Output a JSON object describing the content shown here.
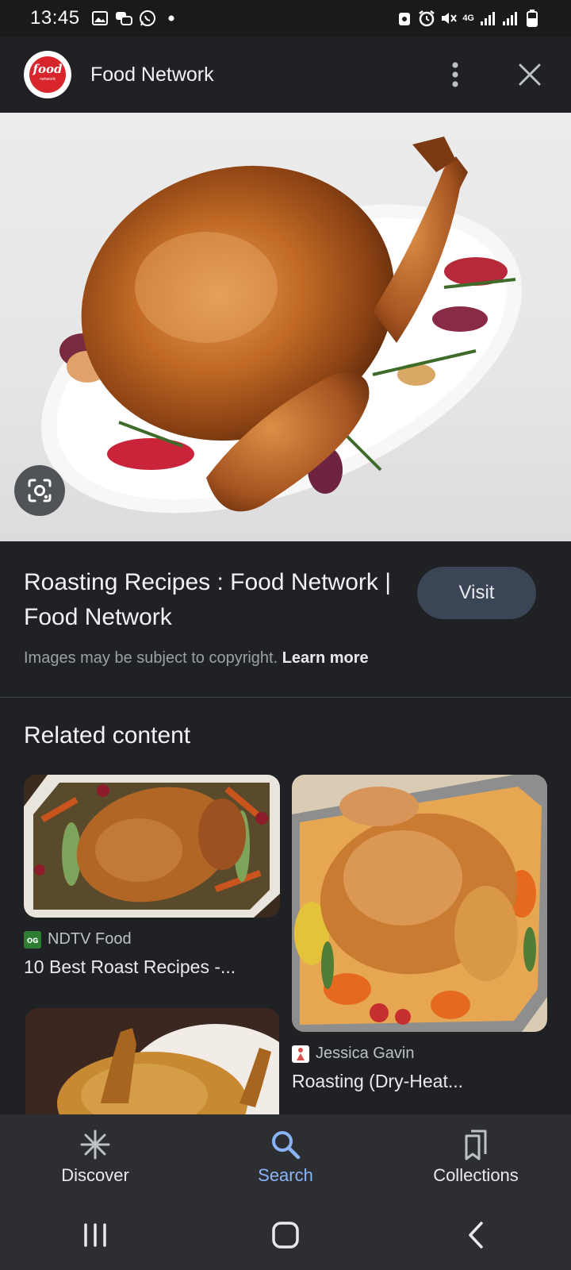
{
  "status_bar": {
    "time": "13:45",
    "network": "4G"
  },
  "header": {
    "site_name": "Food Network",
    "logo_text": "food",
    "logo_subtext": "network"
  },
  "result": {
    "title": "Roasting Recipes : Food Network | Food Network",
    "visit_label": "Visit",
    "copyright_text": "Images may be subject to copyright.",
    "learn_more": "Learn more"
  },
  "related": {
    "title": "Related content",
    "cards": [
      {
        "source": "NDTV Food",
        "caption": "10 Best Roast Recipes -...",
        "favicon_text": "ᴏɢ",
        "favicon_color": "#2e7d32"
      },
      {
        "source": "Jessica Gavin",
        "caption": "Roasting (Dry-Heat...",
        "favicon_text": "",
        "favicon_color": "#ffffff"
      }
    ]
  },
  "bottom_nav": {
    "items": [
      {
        "label": "Discover",
        "icon": "asterisk-icon"
      },
      {
        "label": "Search",
        "icon": "search-icon"
      },
      {
        "label": "Collections",
        "icon": "bookmarks-icon"
      }
    ],
    "active": "Search",
    "active_color": "#8ab4f8"
  },
  "colors": {
    "background": "#202124",
    "visit_button": "#3a4556",
    "brand_red": "#d7252b"
  }
}
